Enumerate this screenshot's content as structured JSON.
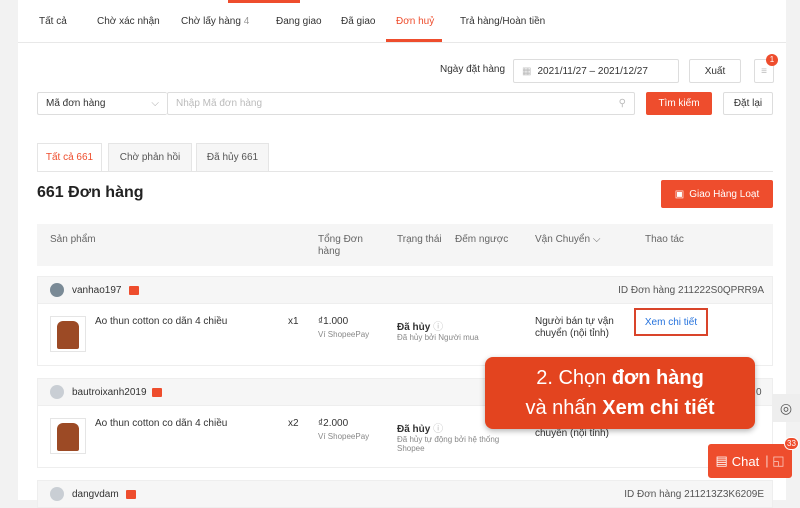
{
  "tabs": [
    {
      "label": "Tất cả"
    },
    {
      "label": "Chờ xác nhận"
    },
    {
      "label": "Chờ lấy hàng",
      "count": "4"
    },
    {
      "label": "Đang giao"
    },
    {
      "label": "Đã giao"
    },
    {
      "label": "Đơn huỷ",
      "active": true
    },
    {
      "label": "Trả hàng/Hoàn tiền"
    }
  ],
  "filters": {
    "date_label": "Ngày đặt hàng",
    "date_range": "2021/11/27 – 2021/12/27",
    "export_label": "Xuất",
    "menu_badge": "1",
    "search_type": "Mã đơn hàng",
    "search_placeholder": "Nhập Mã đơn hàng",
    "search_label": "Tìm kiếm",
    "reset_label": "Đặt lại"
  },
  "subtabs": [
    {
      "label": "Tất cả 661",
      "active": true
    },
    {
      "label": "Chờ phản hồi"
    },
    {
      "label": "Đã hủy 661"
    }
  ],
  "title": "661 Đơn hàng",
  "bulk_ship_label": "Giao Hàng Loạt",
  "columns": [
    "Sản phẩm",
    "Tổng Đơn hàng",
    "Trạng thái",
    "Đếm ngược",
    "Vận Chuyển",
    "Thao tác"
  ],
  "orders": [
    {
      "buyer": "vanhao197",
      "order_id": "ID Đơn hàng 211222S0QPRR9A",
      "product": "Ao thun cotton co dãn 4 chiều",
      "qty": "x1",
      "total": "₫1.000",
      "payment": "Ví ShopeePay",
      "status": "Đã hủy",
      "status_note": "Đã hủy bởi Người mua",
      "shipping": "Người bán tự vận chuyển (nội tỉnh)",
      "action": "Xem chi tiết"
    },
    {
      "buyer": "bautroixanh2019",
      "order_id": "0",
      "product": "Ao thun cotton co dãn 4 chiều",
      "qty": "x2",
      "total": "₫2.000",
      "payment": "Ví ShopeePay",
      "status": "Đã hủy",
      "status_note": "Đã hủy tự động bởi hệ thống Shopee",
      "shipping": "chuyển (nội tỉnh)"
    },
    {
      "buyer": "dangvdam",
      "order_id": "ID Đơn hàng 211213Z3K6209E"
    }
  ],
  "callout": {
    "line1_prefix": "2. Chọn ",
    "line1_bold": "đơn hàng",
    "line2_prefix": "và nhấn ",
    "line2_bold": "Xem chi tiết"
  },
  "chat": {
    "label": "Chat",
    "badge": "33"
  },
  "colors": {
    "accent": "#ee4d2d",
    "link": "#2673dd"
  }
}
